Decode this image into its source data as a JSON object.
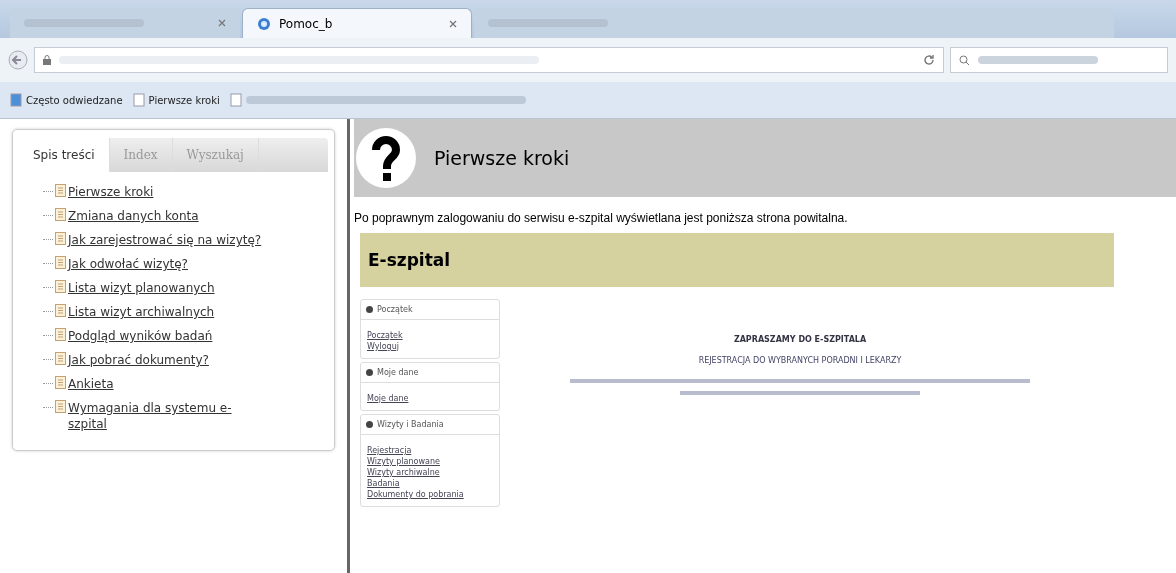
{
  "browser": {
    "tabs": [
      {
        "label": "Pomoc_b",
        "selected": true
      }
    ],
    "bookmarks": [
      "Często odwiedzane",
      "Pierwsze kroki"
    ]
  },
  "help": {
    "tabs": [
      {
        "label": "Spis treści",
        "selected": true
      },
      {
        "label": "Index",
        "selected": false
      },
      {
        "label": "Wyszukaj",
        "selected": false
      }
    ],
    "toc": [
      "Pierwsze kroki",
      "Zmiana danych konta",
      "Jak zarejestrować się na wizytę?",
      "Jak odwołać wizytę?",
      "Lista wizyt planowanych",
      "Lista wizyt archiwalnych",
      "Podgląd wyników badań",
      "Jak pobrać dokumenty?",
      "Ankieta",
      "Wymagania dla systemu e-szpital"
    ]
  },
  "page": {
    "title": "Pierwsze kroki",
    "intro": "Po poprawnym zalogowaniu do serwisu e-szpital wyświetlana jest poniższa strona powitalna.",
    "app": {
      "title": "E-szpital",
      "menu": [
        {
          "heading": "Początek",
          "links": [
            "Początek",
            "Wyloguj"
          ]
        },
        {
          "heading": "Moje dane",
          "links": [
            "Moje dane"
          ]
        },
        {
          "heading": "Wizyty i Badania",
          "links": [
            "Rejestracja",
            "Wizyty planowane",
            "Wizyty archiwalne",
            "Badania",
            "Dokumenty do pobrania"
          ]
        }
      ],
      "welcome": [
        "ZAPRASZAMY DO E-SZPITALA",
        "REJESTRACJA DO WYBRANYCH PORADNI I LEKARZY"
      ]
    }
  }
}
